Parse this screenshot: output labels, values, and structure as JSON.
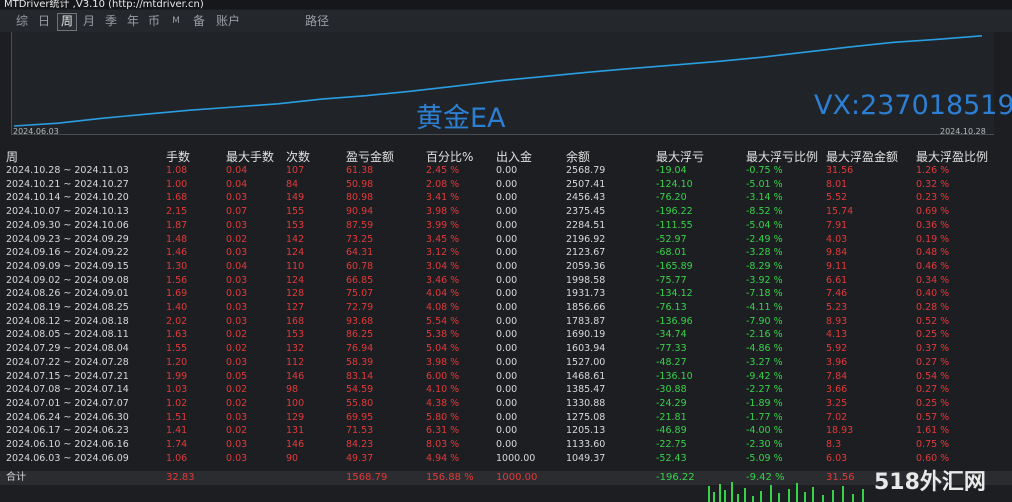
{
  "window": {
    "title": "MTDriver统计 ,V3.10 (http://mtdriver.cn)"
  },
  "tabs": [
    {
      "label": "综",
      "active": false
    },
    {
      "label": "日",
      "active": false
    },
    {
      "label": "周",
      "active": true
    },
    {
      "label": "月",
      "active": false
    },
    {
      "label": "季",
      "active": false
    },
    {
      "label": "年",
      "active": false
    },
    {
      "label": "币",
      "active": false
    },
    {
      "label": "M",
      "active": false
    },
    {
      "label": "备",
      "active": false
    },
    {
      "label": "账户",
      "active": false
    },
    {
      "label": "路径",
      "active": false
    }
  ],
  "chart_data": {
    "type": "line",
    "x": [
      "2024-06-03",
      "2024-06-09",
      "2024-06-16",
      "2024-06-23",
      "2024-06-30",
      "2024-07-07",
      "2024-07-14",
      "2024-07-21",
      "2024-07-28",
      "2024-08-04",
      "2024-08-11",
      "2024-08-18",
      "2024-08-25",
      "2024-09-01",
      "2024-09-08",
      "2024-09-15",
      "2024-09-22",
      "2024-09-29",
      "2024-10-06",
      "2024-10-13",
      "2024-10-20",
      "2024-10-27",
      "2024-11-03"
    ],
    "values": [
      1000.0,
      1049.37,
      1133.6,
      1205.13,
      1275.08,
      1330.88,
      1385.47,
      1468.61,
      1527.0,
      1603.94,
      1690.19,
      1783.87,
      1856.66,
      1931.73,
      1998.58,
      2059.36,
      2123.67,
      2196.92,
      2284.51,
      2375.45,
      2456.43,
      2507.41,
      2568.79
    ],
    "x_start_label": "2024.06.03",
    "x_end_label": "2024.10.28",
    "ylim": [
      1000,
      2600
    ],
    "line_color": "#2a9ee0",
    "watermark_title": "黄金EA",
    "watermark_vx": "VX:237018519"
  },
  "table": {
    "headers": [
      "周",
      "手数",
      "最大手数",
      "次数",
      "盈亏金额",
      "百分比%",
      "出入金",
      "余额",
      "最大浮亏",
      "最大浮亏比例",
      "最大浮盈金额",
      "最大浮盈比例"
    ],
    "rows": [
      [
        "2024.10.28 ~ 2024.11.03",
        "1.08",
        "0.04",
        "107",
        "61.38",
        "2.45 %",
        "0.00",
        "2568.79",
        "-19.04",
        "-0.75 %",
        "31.56",
        "1.26 %"
      ],
      [
        "2024.10.21 ~ 2024.10.27",
        "1.00",
        "0.04",
        "84",
        "50.98",
        "2.08 %",
        "0.00",
        "2507.41",
        "-124.10",
        "-5.01 %",
        "8.01",
        "0.32 %"
      ],
      [
        "2024.10.14 ~ 2024.10.20",
        "1.68",
        "0.03",
        "149",
        "80.98",
        "3.41 %",
        "0.00",
        "2456.43",
        "-76.20",
        "-3.14 %",
        "5.52",
        "0.23 %"
      ],
      [
        "2024.10.07 ~ 2024.10.13",
        "2.15",
        "0.07",
        "155",
        "90.94",
        "3.98 %",
        "0.00",
        "2375.45",
        "-196.22",
        "-8.52 %",
        "15.74",
        "0.69 %"
      ],
      [
        "2024.09.30 ~ 2024.10.06",
        "1.87",
        "0.03",
        "153",
        "87.59",
        "3.99 %",
        "0.00",
        "2284.51",
        "-111.55",
        "-5.04 %",
        "7.91",
        "0.36 %"
      ],
      [
        "2024.09.23 ~ 2024.09.29",
        "1.48",
        "0.02",
        "142",
        "73.25",
        "3.45 %",
        "0.00",
        "2196.92",
        "-52.97",
        "-2.49 %",
        "4.03",
        "0.19 %"
      ],
      [
        "2024.09.16 ~ 2024.09.22",
        "1.46",
        "0.03",
        "124",
        "64.31",
        "3.12 %",
        "0.00",
        "2123.67",
        "-68.01",
        "-3.28 %",
        "9.84",
        "0.48 %"
      ],
      [
        "2024.09.09 ~ 2024.09.15",
        "1.30",
        "0.04",
        "110",
        "60.78",
        "3.04 %",
        "0.00",
        "2059.36",
        "-165.89",
        "-8.29 %",
        "9.11",
        "0.46 %"
      ],
      [
        "2024.09.02 ~ 2024.09.08",
        "1.56",
        "0.03",
        "124",
        "66.85",
        "3.46 %",
        "0.00",
        "1998.58",
        "-75.77",
        "-3.92 %",
        "6.61",
        "0.34 %"
      ],
      [
        "2024.08.26 ~ 2024.09.01",
        "1.69",
        "0.03",
        "128",
        "75.07",
        "4.04 %",
        "0.00",
        "1931.73",
        "-134.12",
        "-7.18 %",
        "7.46",
        "0.40 %"
      ],
      [
        "2024.08.19 ~ 2024.08.25",
        "1.40",
        "0.03",
        "127",
        "72.79",
        "4.08 %",
        "0.00",
        "1856.66",
        "-76.13",
        "-4.11 %",
        "5.23",
        "0.28 %"
      ],
      [
        "2024.08.12 ~ 2024.08.18",
        "2.02",
        "0.03",
        "168",
        "93.68",
        "5.54 %",
        "0.00",
        "1783.87",
        "-136.96",
        "-7.90 %",
        "8.93",
        "0.52 %"
      ],
      [
        "2024.08.05 ~ 2024.08.11",
        "1.63",
        "0.02",
        "153",
        "86.25",
        "5.38 %",
        "0.00",
        "1690.19",
        "-34.74",
        "-2.16 %",
        "4.13",
        "0.25 %"
      ],
      [
        "2024.07.29 ~ 2024.08.04",
        "1.55",
        "0.02",
        "132",
        "76.94",
        "5.04 %",
        "0.00",
        "1603.94",
        "-77.33",
        "-4.86 %",
        "5.92",
        "0.37 %"
      ],
      [
        "2024.07.22 ~ 2024.07.28",
        "1.20",
        "0.03",
        "112",
        "58.39",
        "3.98 %",
        "0.00",
        "1527.00",
        "-48.27",
        "-3.27 %",
        "3.96",
        "0.27 %"
      ],
      [
        "2024.07.15 ~ 2024.07.21",
        "1.99",
        "0.05",
        "146",
        "83.14",
        "6.00 %",
        "0.00",
        "1468.61",
        "-136.10",
        "-9.42 %",
        "7.84",
        "0.54 %"
      ],
      [
        "2024.07.08 ~ 2024.07.14",
        "1.03",
        "0.02",
        "98",
        "54.59",
        "4.10 %",
        "0.00",
        "1385.47",
        "-30.88",
        "-2.27 %",
        "3.66",
        "0.27 %"
      ],
      [
        "2024.07.01 ~ 2024.07.07",
        "1.02",
        "0.02",
        "100",
        "55.80",
        "4.38 %",
        "0.00",
        "1330.88",
        "-24.29",
        "-1.89 %",
        "3.25",
        "0.25 %"
      ],
      [
        "2024.06.24 ~ 2024.06.30",
        "1.51",
        "0.03",
        "129",
        "69.95",
        "5.80 %",
        "0.00",
        "1275.08",
        "-21.81",
        "-1.77 %",
        "7.02",
        "0.57 %"
      ],
      [
        "2024.06.17 ~ 2024.06.23",
        "1.41",
        "0.02",
        "131",
        "71.53",
        "6.31 %",
        "0.00",
        "1205.13",
        "-46.89",
        "-4.00 %",
        "18.93",
        "1.61 %"
      ],
      [
        "2024.06.10 ~ 2024.06.16",
        "1.74",
        "0.03",
        "146",
        "84.23",
        "8.03 %",
        "0.00",
        "1133.60",
        "-22.75",
        "-2.30 %",
        "8.3",
        "0.75 %"
      ],
      [
        "2024.06.03 ~ 2024.06.09",
        "1.06",
        "0.03",
        "90",
        "49.37",
        "4.94 %",
        "1000.00",
        "1049.37",
        "-52.43",
        "-5.09 %",
        "6.03",
        "0.60 %"
      ]
    ],
    "total": [
      "合计",
      "32.83",
      "",
      "",
      "1568.79",
      "156.88 %",
      "1000.00",
      "",
      "-196.22",
      "-9.42 %",
      "31.56",
      ""
    ]
  },
  "site_logo": "518外汇网"
}
